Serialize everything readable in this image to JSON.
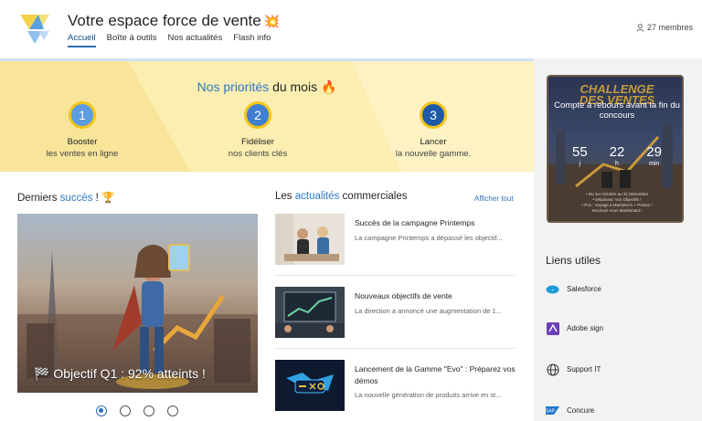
{
  "header": {
    "site_title": "Votre espace force de vente",
    "title_emoji": "💥",
    "nav": [
      {
        "label": "Accueil",
        "active": true
      },
      {
        "label": "Boîte à outils",
        "active": false
      },
      {
        "label": "Nos actualités",
        "active": false
      },
      {
        "label": "Flash info",
        "active": false
      }
    ],
    "members": "27 membres",
    "members_icon": "person-icon"
  },
  "priorities": {
    "title_highlight": "Nos priorités",
    "title_rest": "du mois",
    "title_icon": "fire-icon",
    "items": [
      {
        "number": "1",
        "label": "Booster",
        "sub": "les ventes en ligne",
        "circle_color": "#5b9be0"
      },
      {
        "number": "2",
        "label": "Fidéliser",
        "sub": "nos clients clés",
        "circle_color": "#3f7ed0"
      },
      {
        "number": "3",
        "label": "Lancer",
        "sub": "la nouvelle gamme.",
        "circle_color": "#1f5aa8"
      }
    ]
  },
  "successes": {
    "title_prefix": "Derniers",
    "title_highlight": "succès",
    "title_suffix": "!",
    "title_icon": "trophy-icon",
    "caption": "🏁 Objectif Q1 : 92% atteints !",
    "carousel_count": 4,
    "carousel_active": 0
  },
  "news": {
    "title_prefix": "Les",
    "title_highlight": "actualités",
    "title_suffix": "commerciales",
    "show_all": "Afficher tout",
    "items": [
      {
        "title": "Succès de la campagne Printemps",
        "desc": "La campagne Printemps a dépassé les objectif..."
      },
      {
        "title": "Nouveaux objectifs de vente",
        "desc": "La direction a annoncé une augmentation de 1..."
      },
      {
        "title": "Lancement de la Gamme \"Evo\" : Préparez vos démos",
        "desc": "La nouvelle génération de produits arrive en st..."
      }
    ]
  },
  "challenge": {
    "heading_1": "CHALLENGE",
    "heading_2": "DES VENTES",
    "countdown_label": "Compte à rebours avant la fin du concours",
    "values": [
      {
        "value": "55",
        "unit": "j"
      },
      {
        "value": "22",
        "unit": "h"
      },
      {
        "value": "29",
        "unit": "min"
      }
    ],
    "fine_print": "• Du 1er Octobre au 31 Décembre\n• Dépassez Vos Objectifs !\n• Prix : Voyage à Marrakech + Primes !\nInscrivez-vous Maintenant !"
  },
  "useful_links": {
    "title": "Liens utiles",
    "items": [
      {
        "label": "Salesforce",
        "icon": "salesforce-icon"
      },
      {
        "label": "Adobe sign",
        "icon": "adobe-sign-icon"
      },
      {
        "label": "Support IT",
        "icon": "globe-icon"
      },
      {
        "label": "Concure",
        "icon": "sap-icon"
      }
    ]
  },
  "colors": {
    "accent": "#2f78c4",
    "band": "#fbeeb0",
    "right_panel": "#f2f2f2"
  }
}
